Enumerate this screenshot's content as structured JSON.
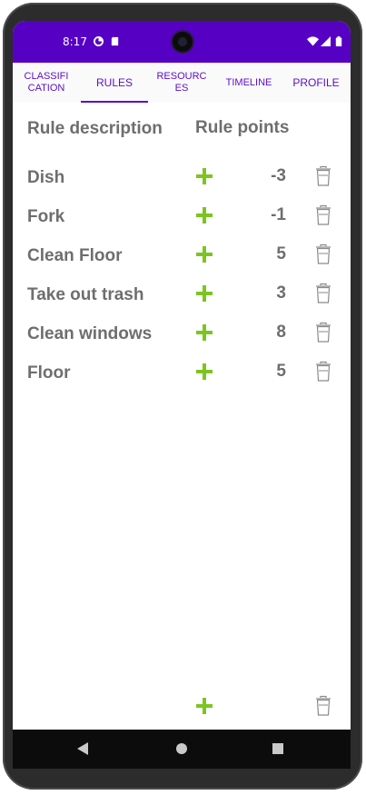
{
  "status_bar": {
    "time": "8:17"
  },
  "tabs": [
    {
      "label": "CLASSIFI\nCATION",
      "active": false
    },
    {
      "label": "RULES",
      "active": true
    },
    {
      "label": "RESOURC\nES",
      "active": false
    },
    {
      "label": "TIMELINE",
      "active": false
    },
    {
      "label": "PROFILE",
      "active": false
    }
  ],
  "table": {
    "header_description": "Rule description",
    "header_points": "Rule points"
  },
  "rules": [
    {
      "description": "Dish",
      "points": "-3"
    },
    {
      "description": "Fork",
      "points": "-1"
    },
    {
      "description": "Clean Floor",
      "points": "5"
    },
    {
      "description": "Take out trash",
      "points": "3"
    },
    {
      "description": "Clean windows",
      "points": "8"
    },
    {
      "description": "Floor",
      "points": "5"
    }
  ],
  "colors": {
    "status_bar": "#5600c4",
    "accent": "#5a0fc8",
    "plus": "#7cc520",
    "text": "#6e6e6e"
  },
  "icons": [
    "add-icon",
    "trash-icon",
    "back-icon",
    "home-icon",
    "recent-apps-icon"
  ]
}
